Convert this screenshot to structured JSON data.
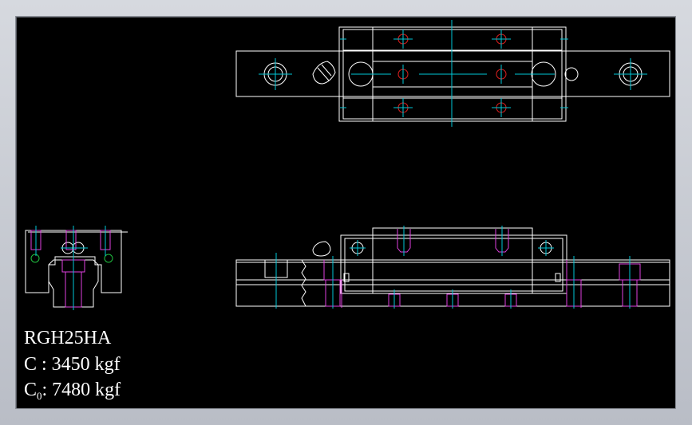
{
  "spec": {
    "model": "RGH25HA",
    "c_prefix": "C",
    "c_value": ": 3450 kgf",
    "c0_prefix": "C",
    "c0_sub": "0",
    "c0_value": ": 7480 kgf"
  },
  "colors": {
    "background": "#000000",
    "outline": "#ffffff",
    "centerline": "#00c8d8",
    "hidden": "#e040e0",
    "hole_red": "#e02020",
    "green": "#20c040"
  }
}
